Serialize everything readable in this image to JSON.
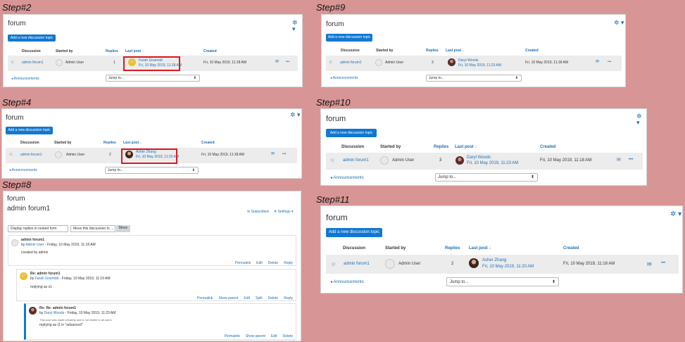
{
  "steps": [
    "Step#2",
    "Step#9",
    "Step#4",
    "Step#10",
    "Step#8",
    "Step#11"
  ],
  "forum": {
    "title": "forum",
    "add_button": "Add a new discussion topic",
    "headers": {
      "discussion": "Discussion",
      "started_by": "Started by",
      "replies": "Replies",
      "last_post": "Last post ↓",
      "created": "Created"
    },
    "discussion": "admin forum1",
    "started_by": "Admin User",
    "created": "Fri, 10 May 2019, 11:18 AM",
    "announcements": "◂ Announcements",
    "jump_to": "Jump to...",
    "caret": "⬍",
    "gear": "✲ ▾",
    "star": "☆",
    "mail": "✉",
    "more": "•••"
  },
  "panels": {
    "step2": {
      "replies": "1",
      "last_name": "Farah Gramold",
      "last_date": "Fri, 10 May 2019, 11:18 AM"
    },
    "step9": {
      "replies": "3",
      "last_name": "Daryl Woods",
      "last_date": "Fri, 10 May 2019, 11:23 AM"
    },
    "step4": {
      "replies": "2",
      "last_name": "Asher Zhang",
      "last_date": "Fri, 10 May 2019, 11:20 AM"
    },
    "step10": {
      "replies": "3",
      "last_name": "Daryl Woods",
      "last_date": "Fri, 10 May 2019, 11:23 AM"
    },
    "step11": {
      "replies": "2",
      "last_name": "Asher Zhang",
      "last_date": "Fri, 10 May 2019, 11:20 AM"
    }
  },
  "thread": {
    "title": "forum",
    "subtitle": "admin forum1",
    "subscribed": "✉ Subscribed",
    "settings": "✲ Settings ▾",
    "display_select": "Display replies in nested form",
    "move_select": "Move this discussion to ...",
    "move_button": "Move",
    "posts": [
      {
        "subject": "admin forum1",
        "by": "by ",
        "author": "Admin User",
        "date": " - Friday, 10 May 2019, 11:18 AM",
        "body": "created by admin",
        "note": "",
        "actions": [
          "Permalink",
          "Edit",
          "Delete",
          "Reply"
        ]
      },
      {
        "subject": "Re: admin forum1",
        "by": "by ",
        "author": "Farah Gramold",
        "date": " - Friday, 10 May 2019, 11:19 AM",
        "body": "replying as s1",
        "note": "",
        "actions": [
          "Permalink",
          "Show parent",
          "Edit",
          "Split",
          "Delete",
          "Reply"
        ]
      },
      {
        "subject": "Re: Re: admin forum1",
        "by": "by ",
        "author": "Daryl Woods",
        "date": " - Friday, 10 May 2019, 11:23 AM",
        "body": "replying as t1 in \"advanced\"",
        "note": "This post was made privately and is not visible to all users.",
        "actions": [
          "Permalink",
          "Show parent",
          "Edit",
          "Delete"
        ]
      }
    ]
  },
  "colors": {
    "accent": "#1177d1",
    "link": "#1d6fb5",
    "highlight": "#e0161c",
    "background": "#d89595"
  }
}
